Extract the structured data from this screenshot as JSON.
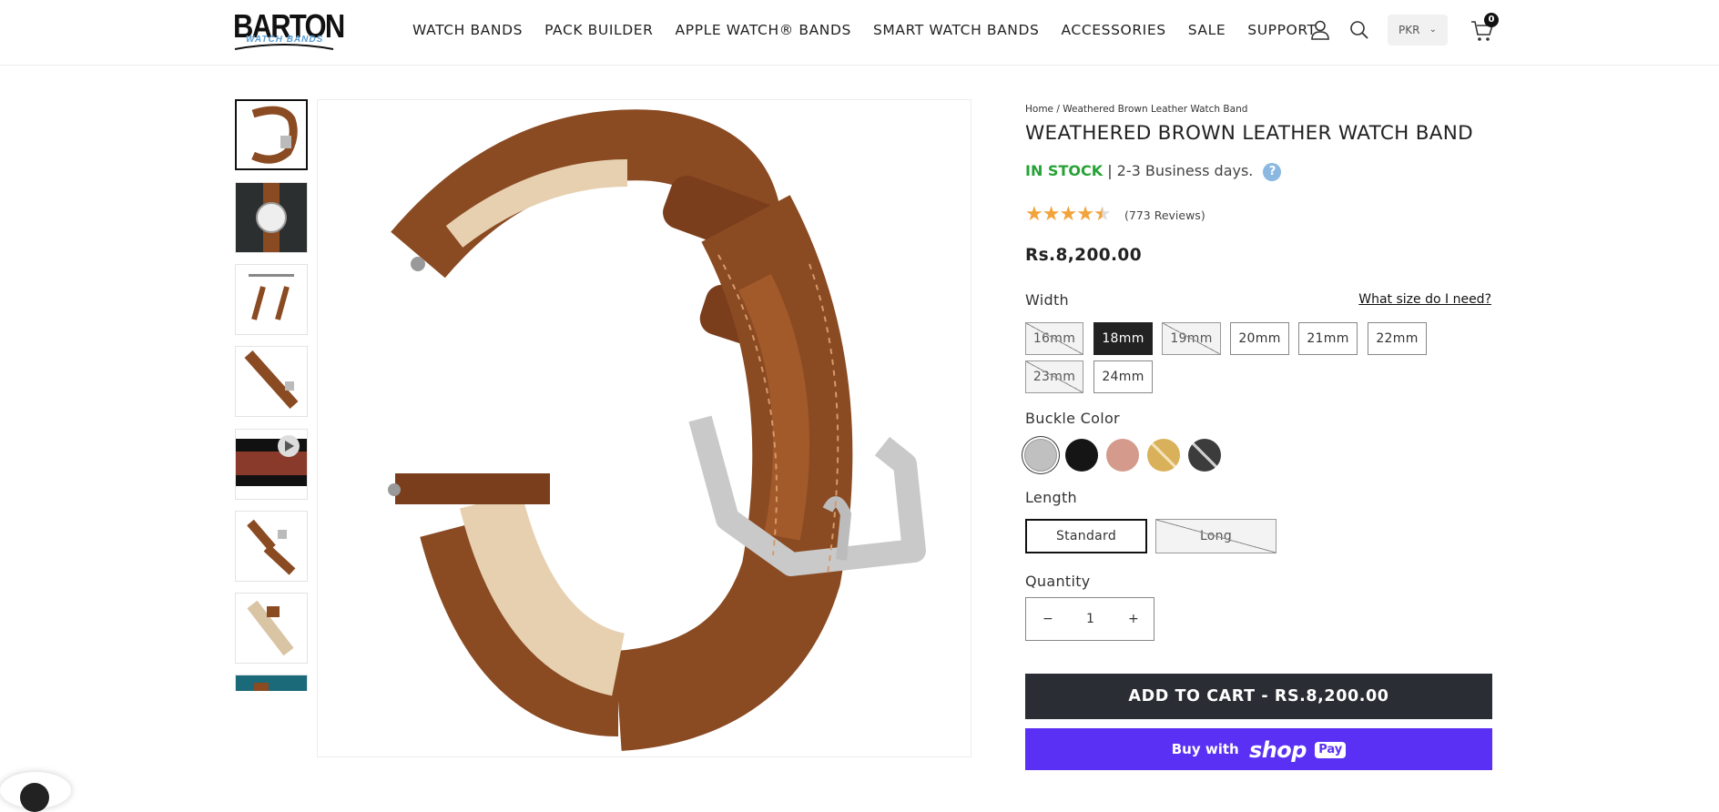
{
  "brand": {
    "logo_text": "BARTON",
    "logo_sub": "WATCH BANDS"
  },
  "nav": {
    "items": [
      "WATCH BANDS",
      "PACK BUILDER",
      "APPLE WATCH® BANDS",
      "SMART WATCH BANDS",
      "ACCESSORIES",
      "SALE",
      "SUPPORT"
    ]
  },
  "header": {
    "account_icon": "user-icon",
    "search_icon": "search-icon",
    "currency": "PKR",
    "cart_icon": "cart-icon",
    "cart_count": "0"
  },
  "product": {
    "breadcrumb": "Home / Weathered Brown Leather Watch Band",
    "title": "WEATHERED BROWN LEATHER WATCH BAND",
    "stock_status": "IN STOCK",
    "stock_separator": "|",
    "shipping": "2-3 Business days.",
    "help": "?",
    "rating": 4.5,
    "reviews": "(773 Reviews)",
    "price": "Rs.8,200.00",
    "width_label": "Width",
    "size_link": "What size do I need?",
    "widths": [
      {
        "label": "16mm",
        "state": "unavailable"
      },
      {
        "label": "18mm",
        "state": "selected"
      },
      {
        "label": "19mm",
        "state": "unavailable"
      },
      {
        "label": "20mm",
        "state": "available"
      },
      {
        "label": "21mm",
        "state": "available"
      },
      {
        "label": "22mm",
        "state": "available"
      },
      {
        "label": "23mm",
        "state": "unavailable"
      },
      {
        "label": "24mm",
        "state": "available"
      }
    ],
    "buckle_label": "Buckle Color",
    "buckle_colors": [
      {
        "name": "silver",
        "color": "#c0c0c0",
        "selected": true
      },
      {
        "name": "black",
        "color": "#151515",
        "selected": false
      },
      {
        "name": "rose-gold",
        "color": "#d49a8c",
        "selected": false
      },
      {
        "name": "gold",
        "color": "#d9b15a",
        "selected": false
      },
      {
        "name": "space-grey",
        "color": "#3c3c3c",
        "selected": false
      }
    ],
    "length_label": "Length",
    "lengths": [
      {
        "label": "Standard",
        "state": "selected"
      },
      {
        "label": "Long",
        "state": "unavailable"
      }
    ],
    "quantity_label": "Quantity",
    "quantity": "1",
    "minus": "−",
    "plus": "+",
    "add_to_cart": "ADD TO CART - RS.8,200.00",
    "buy_with": "Buy with",
    "shop_word": "shop",
    "pay_word": "Pay"
  },
  "colors": {
    "in_stock": "#26a236",
    "star": "#f2a33a",
    "cart_button": "#2a2d33",
    "shop_pay": "#5a31f4",
    "leather": "#8a4a22"
  }
}
